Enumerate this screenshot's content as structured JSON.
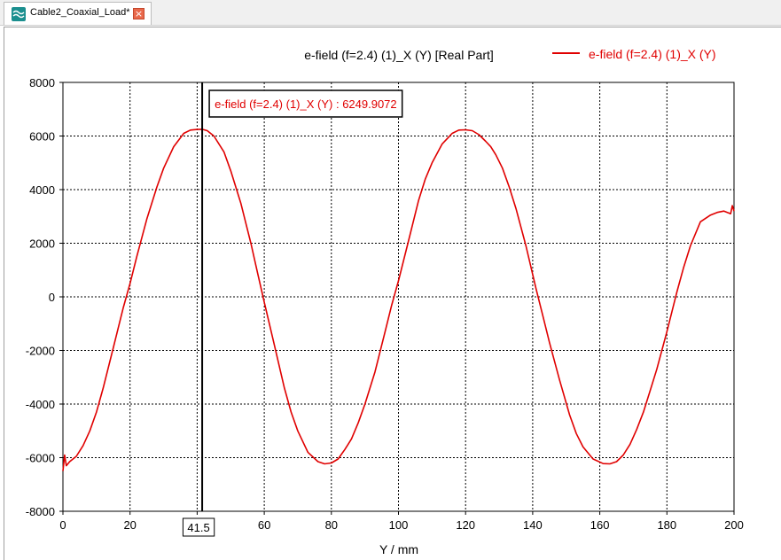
{
  "tab": {
    "label": "Cable2_Coaxial_Load*",
    "close_glyph": "×",
    "icon": "waveform-icon",
    "close_icon": "close-icon"
  },
  "colors": {
    "series": "#e00000",
    "tab_icon": "#1b8f8f",
    "tab_close": "#e9684b"
  },
  "chart_data": {
    "type": "line",
    "title": "e-field (f=2.4) (1)_X (Y) [Real Part]",
    "xlabel": "Y / mm",
    "ylabel": "",
    "xlim": [
      0,
      200
    ],
    "ylim": [
      -8000,
      8000
    ],
    "x_ticks": [
      "0",
      "20",
      "40",
      "60",
      "80",
      "100",
      "120",
      "140",
      "160",
      "180",
      "200"
    ],
    "y_ticks": [
      "8000",
      "6000",
      "4000",
      "2000",
      "0",
      "-2000",
      "-4000",
      "-6000",
      "-8000"
    ],
    "grid": true,
    "legend": {
      "position": "top-right",
      "entries": [
        "e-field (f=2.4) (1)_X (Y)"
      ]
    },
    "series": [
      {
        "name": "e-field (f=2.4) (1)_X (Y)",
        "x": [
          0,
          0.5,
          1,
          2,
          4,
          6,
          8,
          10,
          12,
          15,
          18,
          20,
          22,
          25,
          28,
          30,
          33,
          36,
          38,
          40,
          41.5,
          43,
          45,
          48,
          50,
          53,
          56,
          58,
          60,
          63,
          66,
          68,
          70,
          73,
          76,
          78,
          80,
          82,
          84,
          85,
          86,
          88,
          90,
          93,
          96,
          98,
          100,
          103,
          106,
          108,
          110,
          113,
          116,
          118,
          120,
          122,
          124,
          126,
          127.5,
          129,
          131,
          133,
          135,
          138,
          141,
          143,
          145,
          148,
          151,
          153,
          155,
          158,
          161,
          163,
          165,
          167,
          169,
          171,
          173,
          175,
          177,
          180,
          183,
          185,
          187,
          190,
          193,
          195,
          197,
          199,
          199.5,
          200
        ],
        "values": [
          -6500,
          -5900,
          -6300,
          -6150,
          -5950,
          -5550,
          -5000,
          -4300,
          -3400,
          -1900,
          -400,
          500,
          1500,
          2900,
          4100,
          4800,
          5600,
          6100,
          6220,
          6245,
          6250,
          6200,
          6000,
          5400,
          4700,
          3500,
          2000,
          900,
          -200,
          -1800,
          -3400,
          -4300,
          -5000,
          -5800,
          -6150,
          -6230,
          -6200,
          -6050,
          -5700,
          -5500,
          -5300,
          -4700,
          -4000,
          -2800,
          -1300,
          -300,
          600,
          2100,
          3600,
          4400,
          5000,
          5700,
          6100,
          6220,
          6230,
          6200,
          6050,
          5800,
          5600,
          5300,
          4800,
          4100,
          3300,
          1900,
          300,
          -700,
          -1700,
          -3100,
          -4400,
          -5100,
          -5600,
          -6050,
          -6220,
          -6230,
          -6150,
          -5900,
          -5500,
          -4950,
          -4300,
          -3500,
          -2700,
          -1300,
          200,
          1100,
          1900,
          2800,
          3050,
          3150,
          3200,
          3100,
          3400,
          3200
        ]
      }
    ],
    "marker": {
      "x": 41.5,
      "x_label": "41.5",
      "readout": "e-field (f=2.4) (1)_X (Y) : 6249.9072"
    }
  }
}
